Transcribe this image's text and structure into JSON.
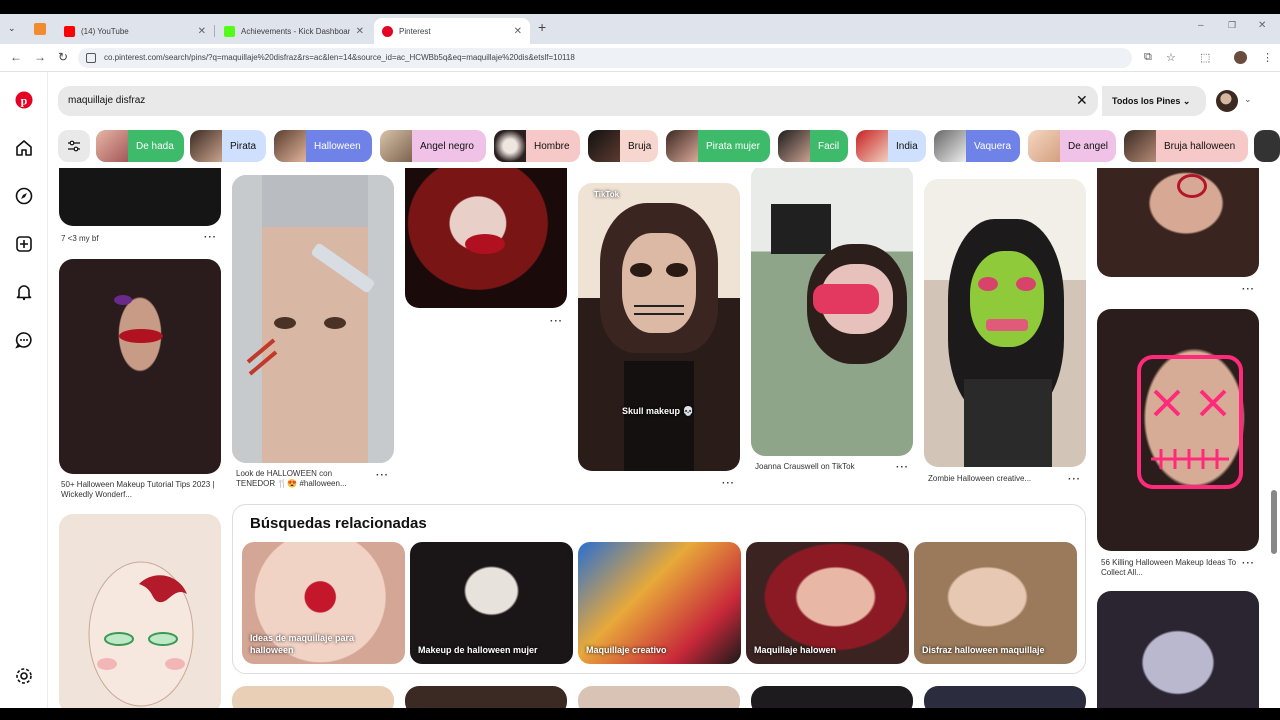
{
  "browser": {
    "tabs": [
      {
        "title": "(14) YouTube",
        "color": "#ff0000"
      },
      {
        "title": "Achievements - Kick Dashboard",
        "color": "#53fc18"
      },
      {
        "title": "Pinterest",
        "color": "#e60023"
      }
    ],
    "new_tab": "+",
    "url": "co.pinterest.com/search/pins/?q=maquillaje%20disfraz&rs=ac&len=14&source_id=ac_HCWBb5q&eq=maquillaje%20dis&etslf=10118",
    "nav": {
      "back": "←",
      "forward": "→",
      "reload": "↻"
    }
  },
  "search": {
    "query": "maquillaje disfraz",
    "clear": "✕",
    "filter_label": "Todos los Pines",
    "filter_chevron": "⌄"
  },
  "chips": [
    {
      "label": "De hada",
      "color": "#3dbb6b"
    },
    {
      "label": "Pirata",
      "color": "#cfe0ff"
    },
    {
      "label": "Halloween",
      "color": "#6f82e8"
    },
    {
      "label": "Angel negro",
      "color": "#f0c2e8"
    },
    {
      "label": "Hombre",
      "color": "#f7c8c8"
    },
    {
      "label": "Bruja",
      "color": "#f7d6d0"
    },
    {
      "label": "Pirata mujer",
      "color": "#3dbb6b"
    },
    {
      "label": "Facil",
      "color": "#3dbb6b"
    },
    {
      "label": "India",
      "color": "#cfe0ff"
    },
    {
      "label": "Vaquera",
      "color": "#6f82e8"
    },
    {
      "label": "De angel",
      "color": "#f0c2e8"
    },
    {
      "label": "Bruja halloween",
      "color": "#f7c8c8"
    }
  ],
  "pins": {
    "col1_top_caption": "7 <3 my bf",
    "col1_mid_caption": "50+ Halloween Makeup Tutorial Tips 2023 | Wickedly Wonderf...",
    "col2_caption": "Look de HALLOWEEN con TENEDOR 🍴😍 #halloween...",
    "col4_overlay_top": "TikTok",
    "col4_overlay": "Skull makeup 💀",
    "col5_caption": "Joanna Crauswell on TikTok",
    "col6_caption": "Zombie Halloween creative...",
    "col7_caption": "56 Killing Halloween Makeup Ideas To Collect All...",
    "more": "···"
  },
  "related": {
    "title": "Búsquedas relacionadas",
    "items": [
      "Ideas de maquillaje para halloween",
      "Makeup de halloween mujer",
      "Maquillaje creativo",
      "Maquillaje halowen",
      "Disfraz halloween maquillaje"
    ]
  },
  "colors": {
    "brand": "#e60023"
  }
}
